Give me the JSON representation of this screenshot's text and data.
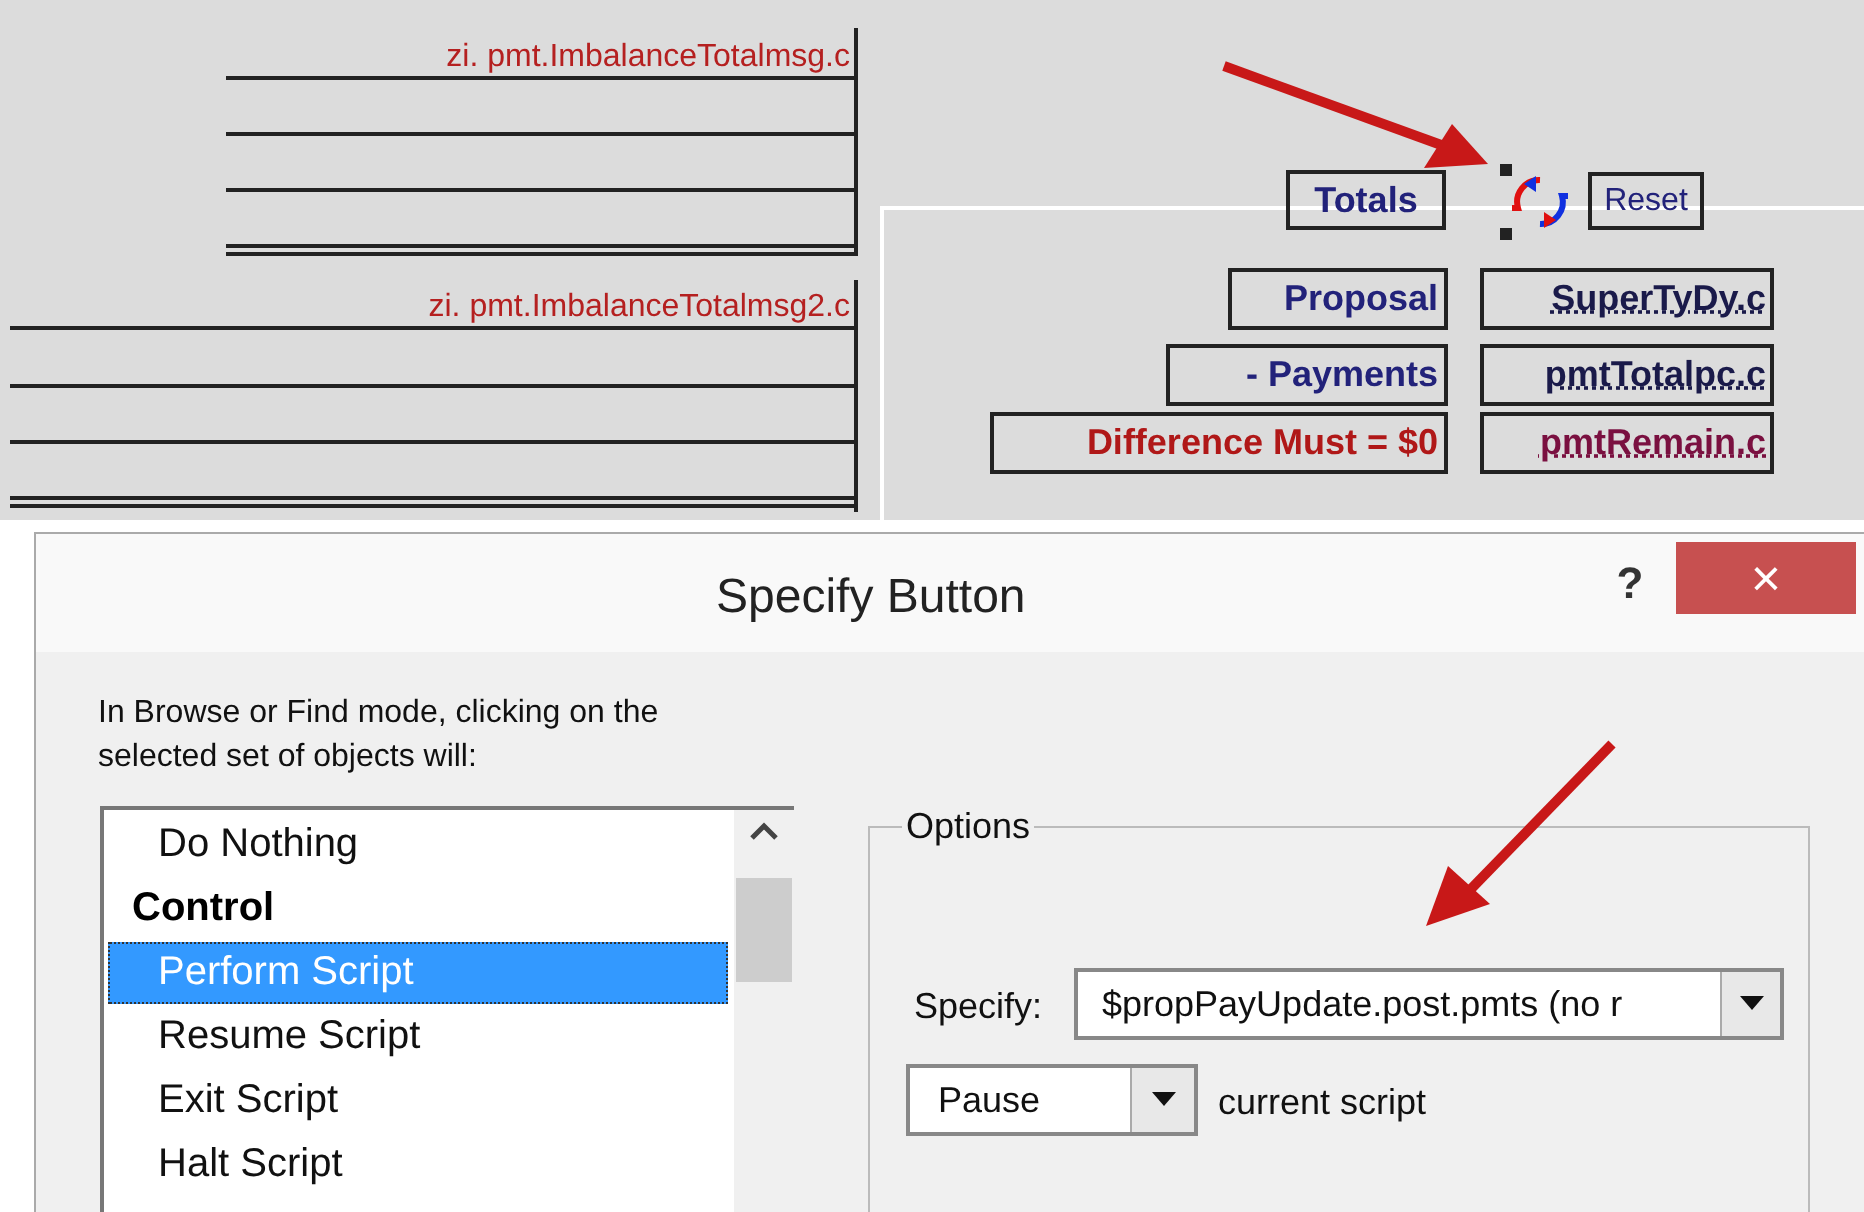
{
  "layout": {
    "fields": [
      {
        "text": "zi. pmt.ImbalanceTotalmsg.c"
      },
      {
        "text": "zi. pmt.ImbalanceTotalmsg2.c"
      }
    ],
    "totals_label": "Totals",
    "reset_button": "Reset",
    "rows": [
      {
        "label": "Proposal",
        "value": "SuperTyDy.c",
        "kind": "normal"
      },
      {
        "label": "- Payments",
        "value": "pmtTotalpc.c",
        "kind": "normal"
      },
      {
        "label": "Difference Must = $0",
        "value": "pmtRemain.c",
        "kind": "warning"
      }
    ]
  },
  "dialog": {
    "title": "Specify Button",
    "help": "?",
    "close": "×",
    "instructions": "In Browse or Find mode, clicking on the selected set of objects will:",
    "actions": [
      {
        "label": "Do Nothing",
        "kind": "item",
        "selected": false
      },
      {
        "label": "Control",
        "kind": "heading"
      },
      {
        "label": "Perform Script",
        "kind": "item",
        "selected": true
      },
      {
        "label": "Resume Script",
        "kind": "item",
        "selected": false
      },
      {
        "label": "Exit Script",
        "kind": "item",
        "selected": false
      },
      {
        "label": "Halt Script",
        "kind": "item",
        "selected": false
      }
    ],
    "options": {
      "legend": "Options",
      "specify_label": "Specify:",
      "specify_value": "$propPayUpdate.post.pmts (no r",
      "pause_value": "Pause",
      "pause_suffix": "current script"
    }
  }
}
